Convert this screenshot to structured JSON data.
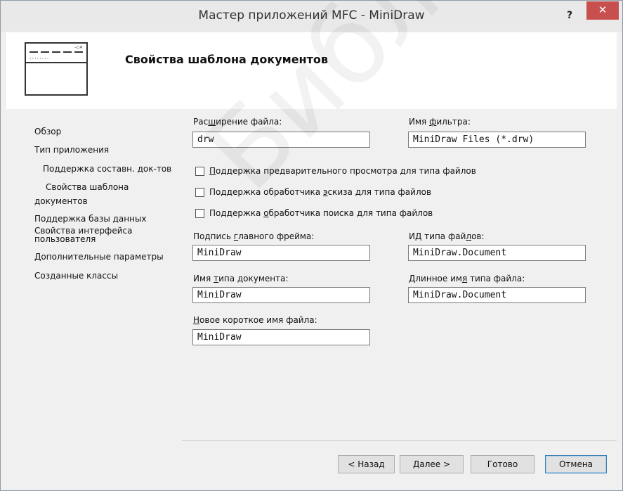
{
  "window": {
    "title": "Мастер приложений MFC - MiniDraw",
    "help_glyph": "?",
    "close_glyph": "✕"
  },
  "header": {
    "title": "Свойства шаблона документов",
    "icon": "window-template-icon"
  },
  "sidebar": {
    "items": [
      {
        "label": "Обзор"
      },
      {
        "label": "Тип приложения"
      },
      {
        "label": "Поддержка составн. док-тов"
      },
      {
        "label": "Свойства шаблона"
      },
      {
        "label": "документов"
      },
      {
        "label": "Поддержка базы данных"
      },
      {
        "label": "Свойства интерфейса"
      },
      {
        "label": "пользователя"
      },
      {
        "label": "Дополнительные параметры"
      },
      {
        "label": "Созданные классы"
      }
    ]
  },
  "form": {
    "file_ext": {
      "label_pre": "Рас",
      "label_u": "ш",
      "label_post": "ирение файла:",
      "value": "drw"
    },
    "filter_name": {
      "label_pre": "Имя ",
      "label_u": "ф",
      "label_post": "ильтра:",
      "value": "MiniDraw Files (*.drw)"
    },
    "checkboxes": [
      {
        "pre": "",
        "u": "П",
        "post": "оддержка предварительного просмотра для типа файлов",
        "checked": false
      },
      {
        "pre": "Поддержка обработчика ",
        "u": "э",
        "post": "скиза для типа файлов",
        "checked": false
      },
      {
        "pre": "Поддержка ",
        "u": "о",
        "post": "бработчика поиска для типа файлов",
        "checked": false
      }
    ],
    "main_frame_caption": {
      "label_pre": "Подпись ",
      "label_u": "г",
      "label_post": "лавного фрейма:",
      "value": "MiniDraw"
    },
    "file_type_id": {
      "label_pre": "ИД типа фай",
      "label_u": "л",
      "label_post": "ов:",
      "value": "MiniDraw.Document"
    },
    "doc_type_name": {
      "label_pre": "Имя ",
      "label_u": "т",
      "label_post": "ипа документа:",
      "value": "MiniDraw"
    },
    "long_file_type_name": {
      "label_pre": "Длинное им",
      "label_u": "я",
      "label_post": " типа файла:",
      "value": "MiniDraw.Document"
    },
    "short_file_name": {
      "label_pre": "",
      "label_u": "Н",
      "label_post": "овое короткое имя файла:",
      "value": "MiniDraw"
    }
  },
  "buttons": {
    "back": "< Назад",
    "next": "Далее >",
    "finish": "Готово",
    "cancel": "Отмена"
  },
  "watermark": "Библиотека БГУИР"
}
